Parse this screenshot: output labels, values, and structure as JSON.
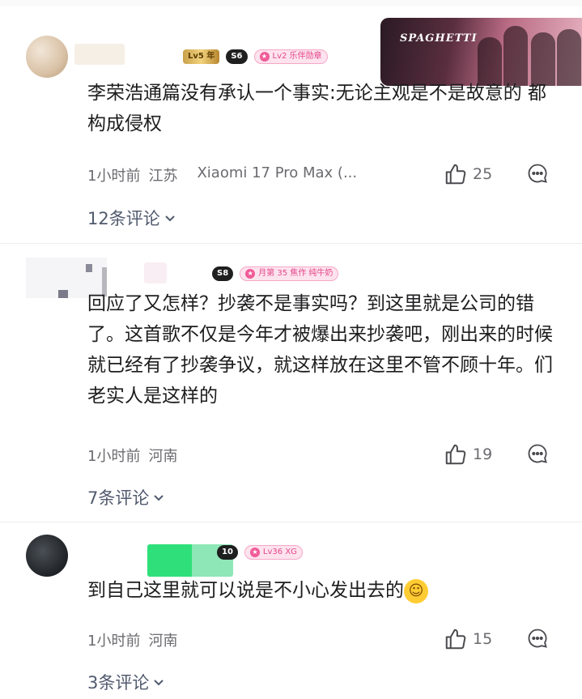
{
  "comments": [
    {
      "badges": [
        "Lv5 年",
        "S6",
        "Lv2 乐伴勋章"
      ],
      "text": "李荣浩通篇没有承认一个事实:无论主观是不是故意的 都构成侵权",
      "time": "1小时前",
      "location": "江苏",
      "device": "Xiaomi 17 Pro Max (...",
      "likes": "25",
      "replies": "12条评论",
      "banner_text": "SPAGHETTI"
    },
    {
      "badges": [
        "S8",
        "月第 35 焦作 纯牛奶"
      ],
      "text": "回应了又怎样？抄袭不是事实吗？到这里就是公司的错了。这首歌不仅是今年才被爆出来抄袭吧，刚出来的时候就已经有了抄袭争议，就这样放在这里不管不顾十年。们老实人是这样的",
      "time": "1小时前",
      "location": "河南",
      "likes": "19",
      "replies": "7条评论"
    },
    {
      "badges": [
        "10",
        "Lv36 XG"
      ],
      "text": "到自己这里就可以说是不小心发出去的",
      "time": "1小时前",
      "location": "河南",
      "likes": "15",
      "replies": "3条评论"
    }
  ],
  "icons": {
    "like": "thumbs-up-icon",
    "reply": "comment-bubble-icon",
    "expand": "chevron-down-icon",
    "emoji": "laughing-tears-emoji-icon"
  },
  "colors": {
    "text": "#1d1d1f",
    "meta": "#6b6b70",
    "replies": "#515a6e",
    "badge_pink": "#e4478a"
  }
}
